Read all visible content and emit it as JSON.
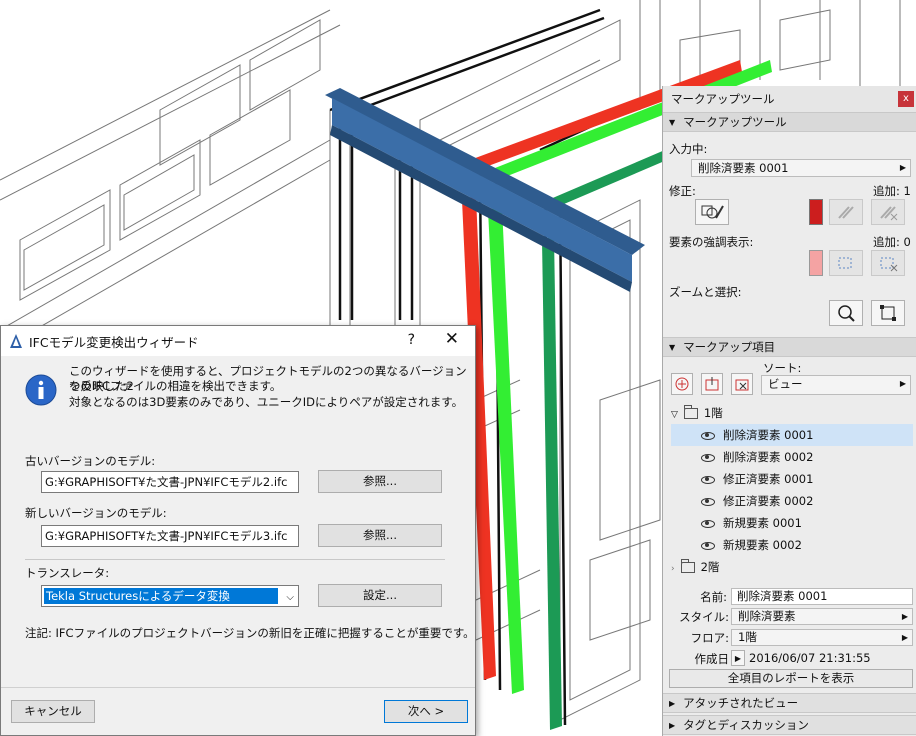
{
  "colors": {
    "beam_blue": "#2f5c8f",
    "red_column": "#ee3322",
    "green_column": "#33ee33",
    "dark_green_column": "#1c9a55",
    "selection": "#cfe3f7",
    "close_red": "#c7343a"
  },
  "markup": {
    "title": "マークアップツール",
    "close_icon": "x",
    "sec_tool": "マークアップツール",
    "input_label": "入力中:",
    "input_value": "削除済要素 0001",
    "modify_label": "修正:",
    "add_count1": "追加: 1",
    "highlight_label": "要素の強調表示:",
    "add_count0": "追加: 0",
    "zoom_label": "ズームと選択:",
    "sec_items": "マークアップ項目",
    "sort_label": "ソート:",
    "sort_value": "ビュー",
    "tree": {
      "floor1": "1階",
      "items": [
        "削除済要素 0001",
        "削除済要素 0002",
        "修正済要素 0001",
        "修正済要素 0002",
        "新規要素 0001",
        "新規要素 0002"
      ],
      "floor2": "2階"
    },
    "name_label": "名前:",
    "name_value": "削除済要素 0001",
    "style_label": "スタイル:",
    "style_value": "削除済要素",
    "floor_label": "フロア:",
    "floor_value": "1階",
    "created_label": "作成日",
    "created_value": "2016/06/07 21:31:55",
    "report_button": "全項目のレポートを表示",
    "sec_attached": "アタッチされたビュー",
    "sec_tags": "タグとディスカッション"
  },
  "dialog": {
    "title": "IFCモデル変更検出ウィザード",
    "help": "?",
    "close": "✕",
    "info_line1": "このウィザードを使用すると、プロジェクトモデルの2つの異なるバージョンを反映した2",
    "info_line2": "つのIFCファイルの相違を検出できます。",
    "info_line3": "対象となるのは3D要素のみであり、ユニークIDによりペアが設定されます。",
    "old_label": "古いバージョンのモデル:",
    "old_path": "G:¥GRAPHISOFT¥た文書-JPN¥IFCモデル2.ifc",
    "browse1": "参照...",
    "new_label": "新しいバージョンのモデル:",
    "new_path": "G:¥GRAPHISOFT¥た文書-JPN¥IFCモデル3.ifc",
    "browse2": "参照...",
    "translator_label": "トランスレータ:",
    "translator_value": "Tekla Structuresによるデータ変換",
    "settings": "設定...",
    "note": "注記: IFCファイルのプロジェクトバージョンの新旧を正確に把握することが重要です。",
    "cancel": "キャンセル",
    "next": "次へ >"
  }
}
